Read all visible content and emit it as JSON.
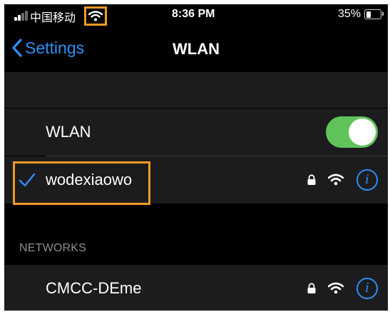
{
  "status_bar": {
    "carrier": "中国移动",
    "time": "8:36 PM",
    "battery_percent": "35%",
    "battery_level": 0.35,
    "wifi_icon": "wifi-icon",
    "signal_bars_filled": 2
  },
  "nav": {
    "back_label": "Settings",
    "title": "WLAN"
  },
  "wlan_toggle": {
    "label": "WLAN",
    "on": true
  },
  "connected_network": {
    "name": "wodexiaowo",
    "secured": true,
    "checked": true
  },
  "networks_section": {
    "header": "NETWORKS",
    "items": [
      {
        "name": "CMCC-DEme",
        "secured": true
      }
    ]
  },
  "colors": {
    "accent": "#2f8ef5",
    "toggle_on": "#5fc35a",
    "highlight": "#f39a23",
    "cell_bg": "#1c1c1e"
  }
}
